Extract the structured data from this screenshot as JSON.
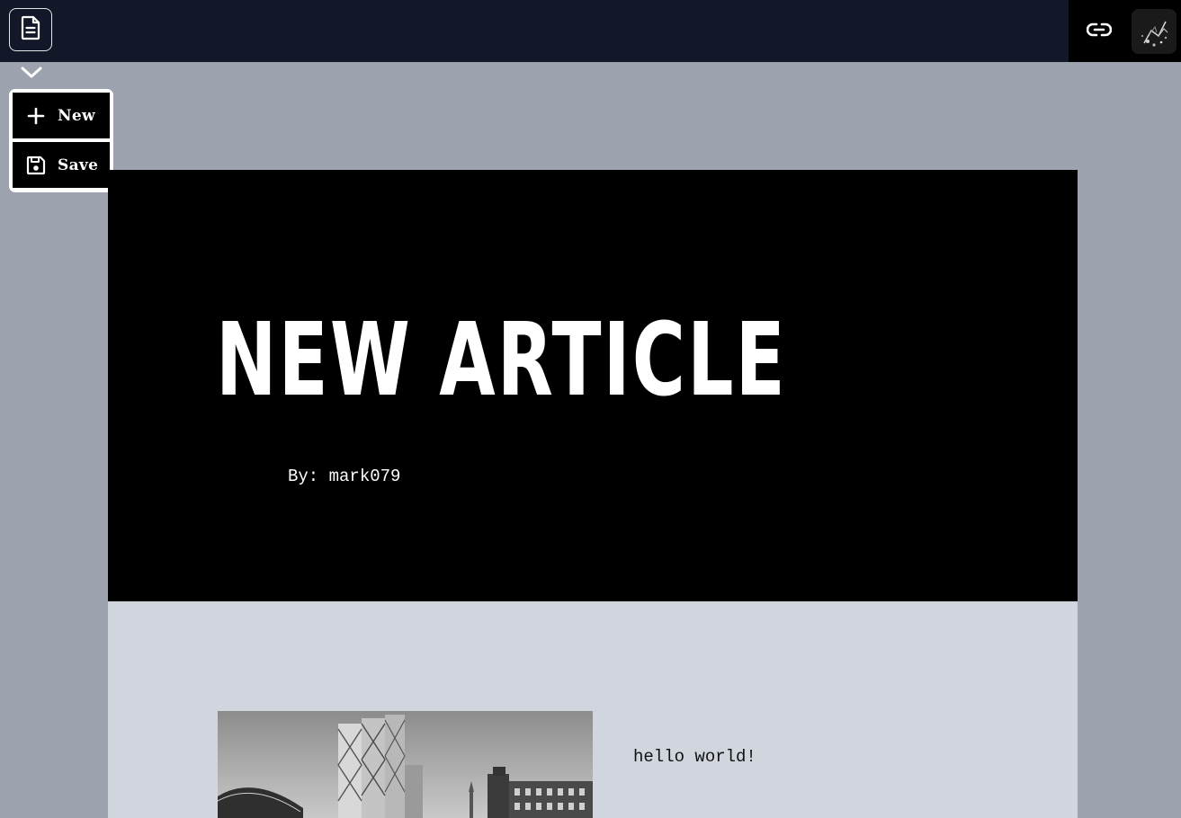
{
  "topbar": {
    "doc_icon": "document-icon",
    "link_icon": "link-icon",
    "avatar_icon": "avatar-image"
  },
  "menu": {
    "toggle_icon": "chevron-down-icon",
    "items": [
      {
        "label": "New",
        "icon": "plus-icon"
      },
      {
        "label": "Save",
        "icon": "floppy-disk-icon"
      }
    ]
  },
  "article": {
    "title": "NEW ARTICLE",
    "byline_prefix": "By:",
    "author": "mark079",
    "body_text": "hello world!"
  },
  "colors": {
    "topbar_bg": "#121828",
    "page_bg": "#9ca3af",
    "hero_bg": "#000000",
    "content_bg": "#d1d5de"
  }
}
